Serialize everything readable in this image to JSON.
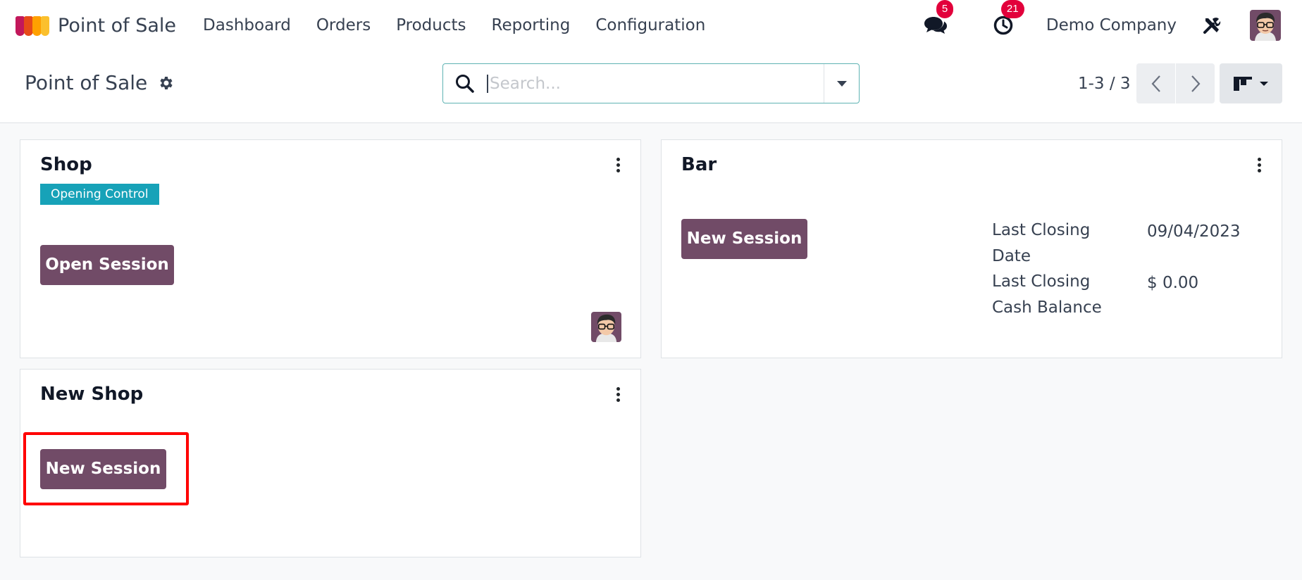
{
  "navbar": {
    "app_name": "Point of Sale",
    "menu": [
      "Dashboard",
      "Orders",
      "Products",
      "Reporting",
      "Configuration"
    ],
    "messages_count": "5",
    "activities_count": "21",
    "company": "Demo Company"
  },
  "control_panel": {
    "title": "Point of Sale",
    "search_placeholder": "Search...",
    "pager": "1-3 / 3"
  },
  "cards": [
    {
      "title": "Shop",
      "tag": "Opening Control",
      "button": "Open Session"
    },
    {
      "title": "Bar",
      "button": "New Session",
      "info": [
        {
          "label": "Last Closing Date",
          "value": "09/04/2023"
        },
        {
          "label": "Last Closing Cash Balance",
          "value": "$ 0.00"
        }
      ]
    },
    {
      "title": "New Shop",
      "button": "New Session"
    }
  ],
  "colors": {
    "primary": "#714b67",
    "tag": "#17a2b8",
    "badge": "#e2003b",
    "highlight": "#ff0000"
  }
}
